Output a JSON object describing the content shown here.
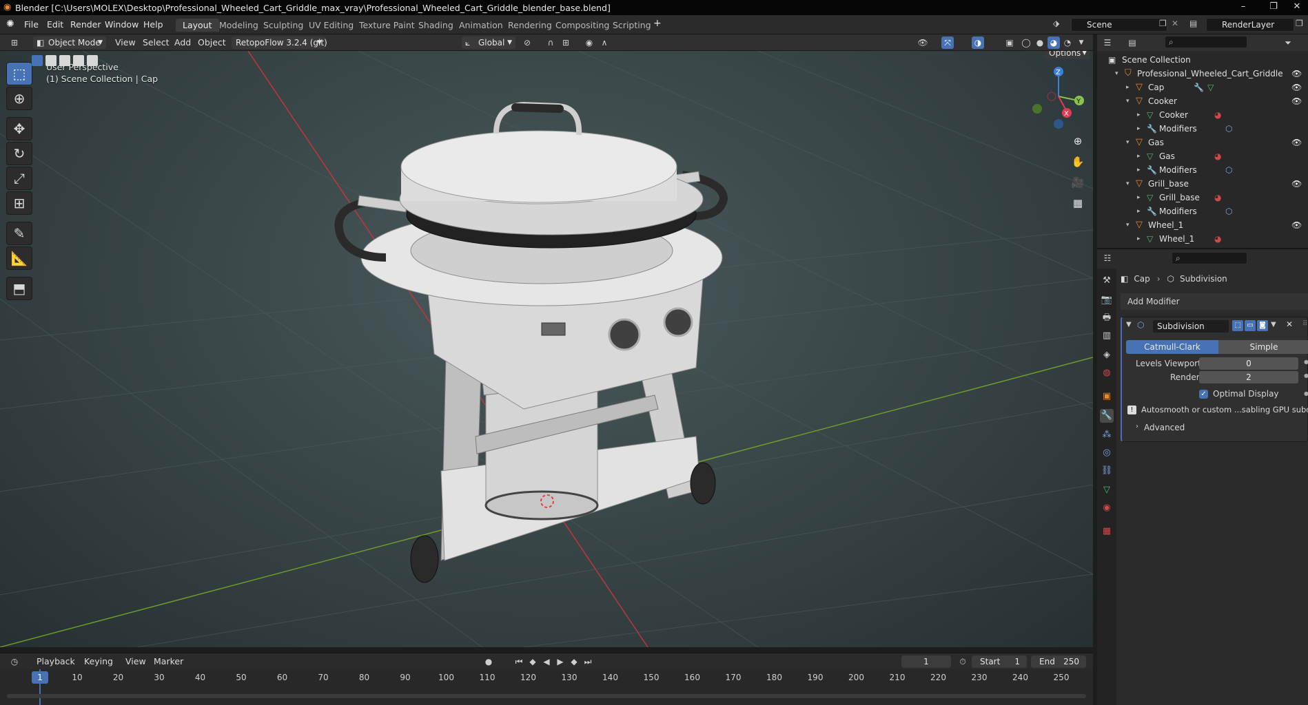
{
  "window": {
    "title": "Blender [C:\\Users\\MOLEX\\Desktop\\Professional_Wheeled_Cart_Griddle_max_vray\\Professional_Wheeled_Cart_Griddle_blender_base.blend]",
    "minimize": "–",
    "restore": "❐",
    "close": "✕"
  },
  "menu": {
    "file": "File",
    "edit": "Edit",
    "render": "Render",
    "window": "Window",
    "help": "Help"
  },
  "workspaces": [
    "Layout",
    "Modeling",
    "Sculpting",
    "UV Editing",
    "Texture Paint",
    "Shading",
    "Animation",
    "Rendering",
    "Compositing",
    "Scripting"
  ],
  "workspace_add": "+",
  "scene": {
    "name": "Scene",
    "render_layer": "RenderLayer"
  },
  "viewport_header": {
    "mode": "Object Mode",
    "view": "View",
    "select": "Select",
    "add": "Add",
    "object": "Object",
    "addon": "RetopoFlow 3.2.4 (git)",
    "orientation": "Global",
    "options": "Options"
  },
  "viewport": {
    "perspective": "User Perspective",
    "collection": "(1) Scene Collection | Cap",
    "gizmo": {
      "z": "Z",
      "y": "Y",
      "x": "X"
    }
  },
  "outliner": {
    "root": "Scene Collection",
    "items": [
      {
        "label": "Professional_Wheeled_Cart_Griddle",
        "level": 1,
        "kind": "collection"
      },
      {
        "label": "Cap",
        "level": 2,
        "kind": "object"
      },
      {
        "label": "Cooker",
        "level": 2,
        "kind": "object"
      },
      {
        "label": "Cooker",
        "level": 3,
        "kind": "mesh"
      },
      {
        "label": "Modifiers",
        "level": 3,
        "kind": "modifiers"
      },
      {
        "label": "Gas",
        "level": 2,
        "kind": "object"
      },
      {
        "label": "Gas",
        "level": 3,
        "kind": "mesh"
      },
      {
        "label": "Modifiers",
        "level": 3,
        "kind": "modifiers"
      },
      {
        "label": "Grill_base",
        "level": 2,
        "kind": "object"
      },
      {
        "label": "Grill_base",
        "level": 3,
        "kind": "mesh"
      },
      {
        "label": "Modifiers",
        "level": 3,
        "kind": "modifiers"
      },
      {
        "label": "Wheel_1",
        "level": 2,
        "kind": "object"
      },
      {
        "label": "Wheel_1",
        "level": 3,
        "kind": "mesh"
      }
    ]
  },
  "properties": {
    "breadcrumb_object": "Cap",
    "breadcrumb_sep": "›",
    "breadcrumb_modifier": "Subdivision",
    "add_modifier": "Add Modifier",
    "modifier": {
      "name": "Subdivision",
      "algo_catmull": "Catmull-Clark",
      "algo_simple": "Simple",
      "levels_viewport_label": "Levels Viewport",
      "levels_viewport": "0",
      "render_label": "Render",
      "render": "2",
      "optimal_display": "Optimal Display",
      "warning": "Autosmooth or custom ...sabling GPU subdivision",
      "advanced": "Advanced"
    }
  },
  "timeline": {
    "playback": "Playback",
    "keying": "Keying",
    "view": "View",
    "marker": "Marker",
    "current_frame": "1",
    "start_label": "Start",
    "start": "1",
    "end_label": "End",
    "end": "250",
    "ticks": [
      "1",
      "10",
      "20",
      "30",
      "40",
      "50",
      "60",
      "70",
      "80",
      "90",
      "100",
      "110",
      "120",
      "130",
      "140",
      "150",
      "160",
      "170",
      "180",
      "190",
      "200",
      "210",
      "220",
      "230",
      "240",
      "250"
    ]
  },
  "colors": {
    "accent": "#4772b3",
    "x_axis": "#c0353f",
    "y_axis": "#6e9b2a",
    "object_icon": "#e5882d",
    "mesh_icon": "#4fbe75"
  }
}
